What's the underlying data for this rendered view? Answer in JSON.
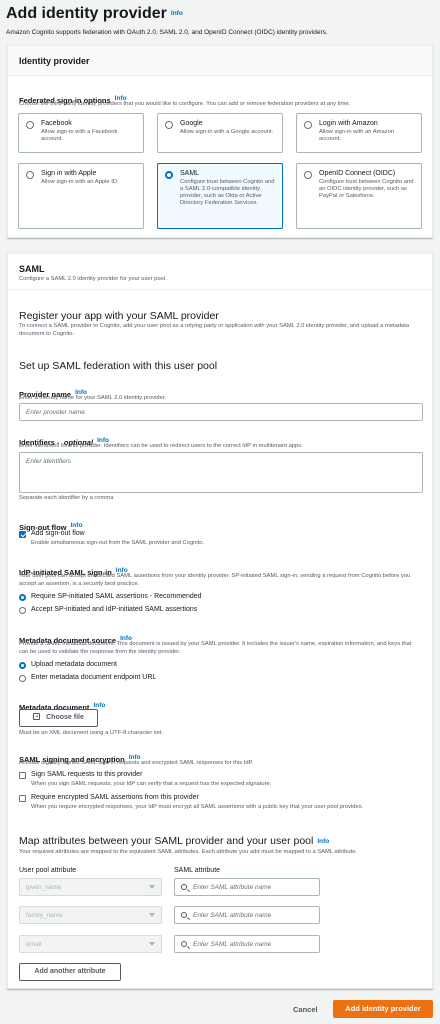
{
  "header": {
    "title": "Add identity provider",
    "info": "Info",
    "description": "Amazon Cognito supports federation with OAuth 2.0, SAML 2.0, and OpenID Connect (OIDC) identity providers."
  },
  "identity_provider_panel": {
    "title": "Identity provider",
    "federated_label": "Federated sign-in options",
    "info": "Info",
    "federated_desc": "Choose the third-party identity providers that you would like to configure. You can add or remove federation providers at any time.",
    "options": [
      {
        "title": "Facebook",
        "desc": "Allow sign-in with a Facebook account."
      },
      {
        "title": "Google",
        "desc": "Allow sign-in with a Google account."
      },
      {
        "title": "Login with Amazon",
        "desc": "Allow sign-in with an Amazon account."
      },
      {
        "title": "Sign in with Apple",
        "desc": "Allow sign-in with an Apple ID."
      },
      {
        "title": "SAML",
        "desc": "Configure trust between Cognito and a SAML 2.0-compatible identity provider, such as Okta or Active Directory Federation Services."
      },
      {
        "title": "OpenID Connect (OIDC)",
        "desc": "Configure trust between Cognito and an OIDC identity provider, such as PayPal or Salesforce."
      }
    ],
    "selected": "SAML"
  },
  "saml_panel": {
    "title": "SAML",
    "subtitle": "Configure a SAML 2.0 identity provider for your user pool.",
    "register_title": "Register your app with your SAML provider",
    "register_desc": "To connect a SAML provider to Cognito, add your user pool as a relying party or application with your SAML 2.0 identity provider, and upload a metadata document to Cognito.",
    "setup_title": "Set up SAML federation with this user pool",
    "provider_name": {
      "label": "Provider name",
      "info": "Info",
      "desc": "Enter a friendly name for your SAML 2.0 identity provider.",
      "placeholder": "Enter provider name"
    },
    "identifiers": {
      "label": "Identifiers -",
      "optional": "optional",
      "info": "Info",
      "desc": "Enter identifiers for this provider. Identifiers can be used to redirect users to the correct IdP in multitenant apps.",
      "placeholder": "Enter identifiers",
      "hint": "Separate each identifier by a comma"
    },
    "signout": {
      "label": "Sign-out flow",
      "info": "Info",
      "checkbox_label": "Add sign-out flow",
      "checkbox_desc": "Enable simultaneous sign-out from the SAML provider and Cognito.",
      "checked": true
    },
    "idp_initiated": {
      "label": "IdP-initiated SAML sign-in",
      "info": "Info",
      "desc": "Your user pool can accept unsolicited SAML assertions from your identity provider. SP-initiated SAML sign-in, sending a request from Cognito before you accept an assertion, is a security best practice.",
      "options": [
        "Require SP-initiated SAML assertions - Recommended",
        "Accept SP-initiated and IdP-initiated SAML assertions"
      ],
      "selected_index": 0
    },
    "metadata_source": {
      "label": "Metadata document source",
      "info": "Info",
      "desc": "Provide a SAML metadata document. This document is issued by your SAML provider. It includes the issuer's name, expiration information, and keys that can be used to validate the response from the identity provider.",
      "options": [
        "Upload metadata document",
        "Enter metadata document endpoint URL"
      ],
      "selected_index": 0
    },
    "metadata_document": {
      "label": "Metadata document",
      "info": "Info",
      "button": "Choose file",
      "hint": "Must be an XML document using a UTF-8 character set."
    },
    "signing": {
      "label": "SAML signing and encryption",
      "info": "Info",
      "desc": "Activate digitally-signed SAML sign-in requests and encrypted SAML responses for this IdP.",
      "options": [
        {
          "label": "Sign SAML requests to this provider",
          "desc": "When you sign SAML requests, your IdP can verify that a request has the expected signature."
        },
        {
          "label": "Require encrypted SAML assertions from this provider",
          "desc": "When you require encrypted responses, your IdP must encrypt all SAML assertions with a public key that your user pool provides."
        }
      ]
    },
    "map": {
      "title": "Map attributes between your SAML provider and your user pool",
      "info": "Info",
      "desc": "Your required attributes are mapped to the equivalent SAML attributes. Each attribute you add must be mapped to a SAML attribute.",
      "col_user": "User pool attribute",
      "col_saml": "SAML attribute",
      "rows": [
        {
          "user": "given_name",
          "placeholder": "Enter SAML attribute name"
        },
        {
          "user": "family_name",
          "placeholder": "Enter SAML attribute name"
        },
        {
          "user": "email",
          "placeholder": "Enter SAML attribute name"
        }
      ],
      "add_button": "Add another attribute"
    }
  },
  "footer": {
    "cancel": "Cancel",
    "submit": "Add identity provider"
  }
}
